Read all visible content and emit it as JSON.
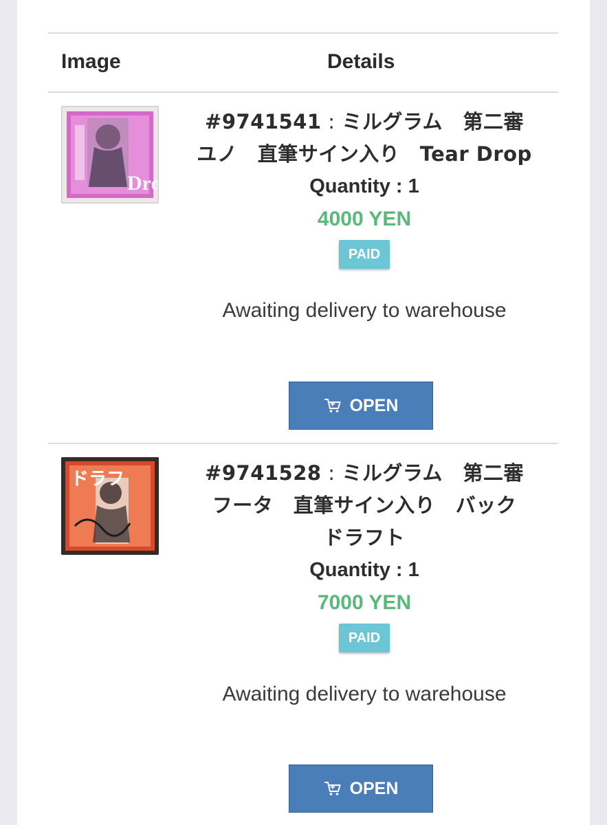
{
  "table": {
    "headers": {
      "image": "Image",
      "details": "Details"
    }
  },
  "items": [
    {
      "id": "#9741541",
      "separator": " : ",
      "title_line1": "ミルグラム　第二審",
      "title_line2": "ユノ　直筆サイン入り　Tear Drop",
      "title_line3": "",
      "quantity": "Quantity : 1",
      "price": "4000 YEN",
      "badge": "PAID",
      "status": "Awaiting delivery to warehouse",
      "button": "OPEN",
      "thumb_logo_text": "Drop",
      "thumb_colors": [
        "#c65bbf",
        "#e18bd8",
        "#f2c4ee"
      ]
    },
    {
      "id": "#9741528",
      "separator": " : ",
      "title_line1": "ミルグラム　第二審",
      "title_line2": "フータ　直筆サイン入り　バック",
      "title_line3": "ドラフト",
      "quantity": "Quantity : 1",
      "price": "7000 YEN",
      "badge": "PAID",
      "status": "Awaiting delivery to warehouse",
      "button": "OPEN",
      "thumb_logo_text": "ドラフ",
      "thumb_colors": [
        "#d84a2d",
        "#ef7b55",
        "#2b2020"
      ]
    }
  ],
  "colors": {
    "price_green": "#58b97a",
    "badge_cyan": "#6cc6d6",
    "button_blue": "#4a7eb9"
  },
  "icons": {
    "cart": "cart-icon"
  }
}
